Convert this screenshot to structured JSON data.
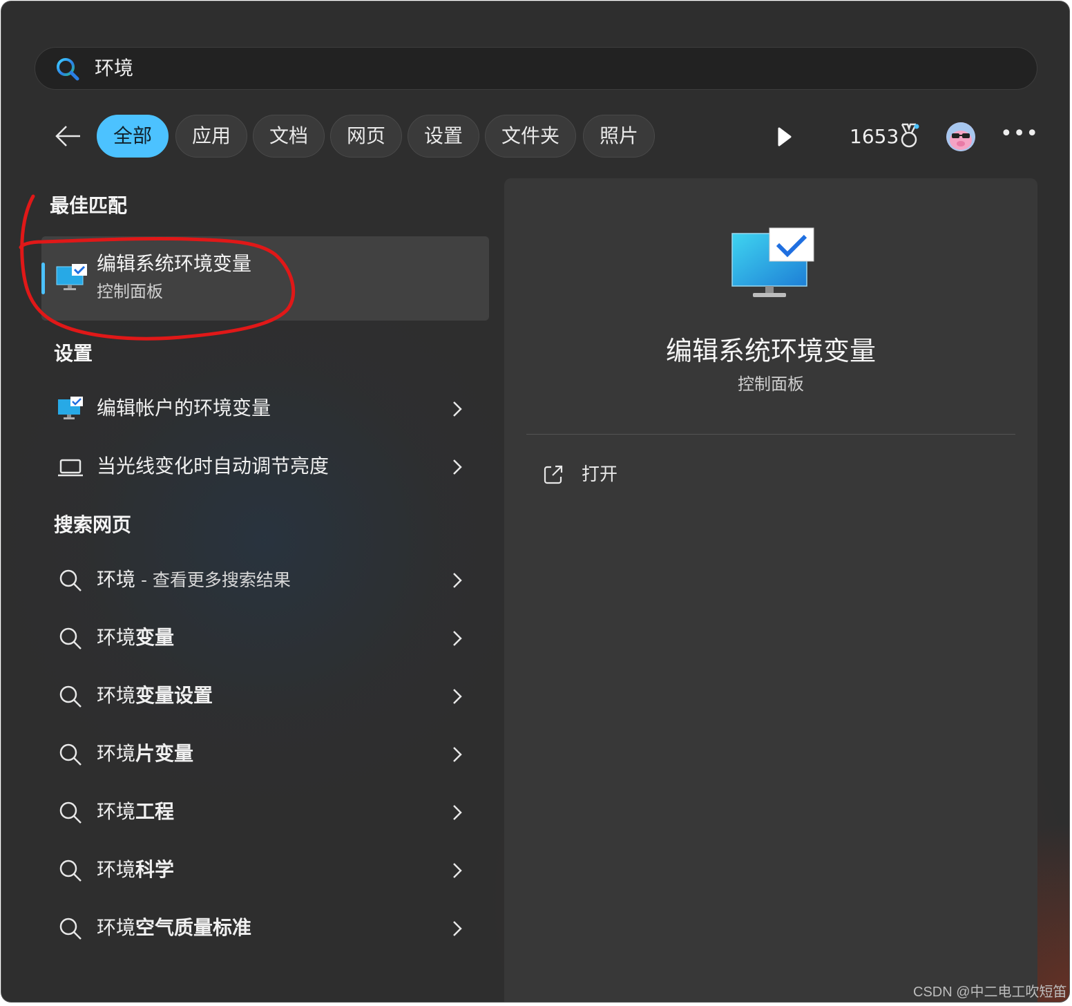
{
  "search": {
    "query": "环境"
  },
  "filters": [
    {
      "label": "全部",
      "active": true
    },
    {
      "label": "应用"
    },
    {
      "label": "文档"
    },
    {
      "label": "网页"
    },
    {
      "label": "设置"
    },
    {
      "label": "文件夹"
    },
    {
      "label": "照片"
    }
  ],
  "toolbar": {
    "points": "1653",
    "icons": [
      "back-arrow-icon",
      "play-icon",
      "medal-icon",
      "avatar",
      "more-icon"
    ]
  },
  "best_match": {
    "section_title": "最佳匹配",
    "title": "编辑系统环境变量",
    "subtitle": "控制面板"
  },
  "settings": {
    "section_title": "设置",
    "items": [
      {
        "label": "编辑帐户的环境变量",
        "icon": "monitor-check-icon"
      },
      {
        "label": "当光线变化时自动调节亮度",
        "icon": "laptop-icon"
      }
    ]
  },
  "web": {
    "section_title": "搜索网页",
    "items": [
      {
        "prefix": "环境",
        "suffix": " - 查看更多搜索结果"
      },
      {
        "prefix": "环境",
        "suffix": "变量"
      },
      {
        "prefix": "环境",
        "suffix": "变量设置"
      },
      {
        "prefix": "环境",
        "suffix": "片变量"
      },
      {
        "prefix": "环境",
        "suffix": "工程"
      },
      {
        "prefix": "环境",
        "suffix": "科学"
      },
      {
        "prefix": "环境",
        "suffix": "空气质量标准"
      }
    ]
  },
  "detail": {
    "title": "编辑系统环境变量",
    "subtitle": "控制面板",
    "actions": [
      {
        "label": "打开",
        "icon": "open-external-icon"
      }
    ]
  },
  "watermark": "CSDN @中二电工吹短笛",
  "colors": {
    "accent": "#4cc2ff",
    "annotation": "#e01818",
    "background": "#2e2e2e"
  }
}
